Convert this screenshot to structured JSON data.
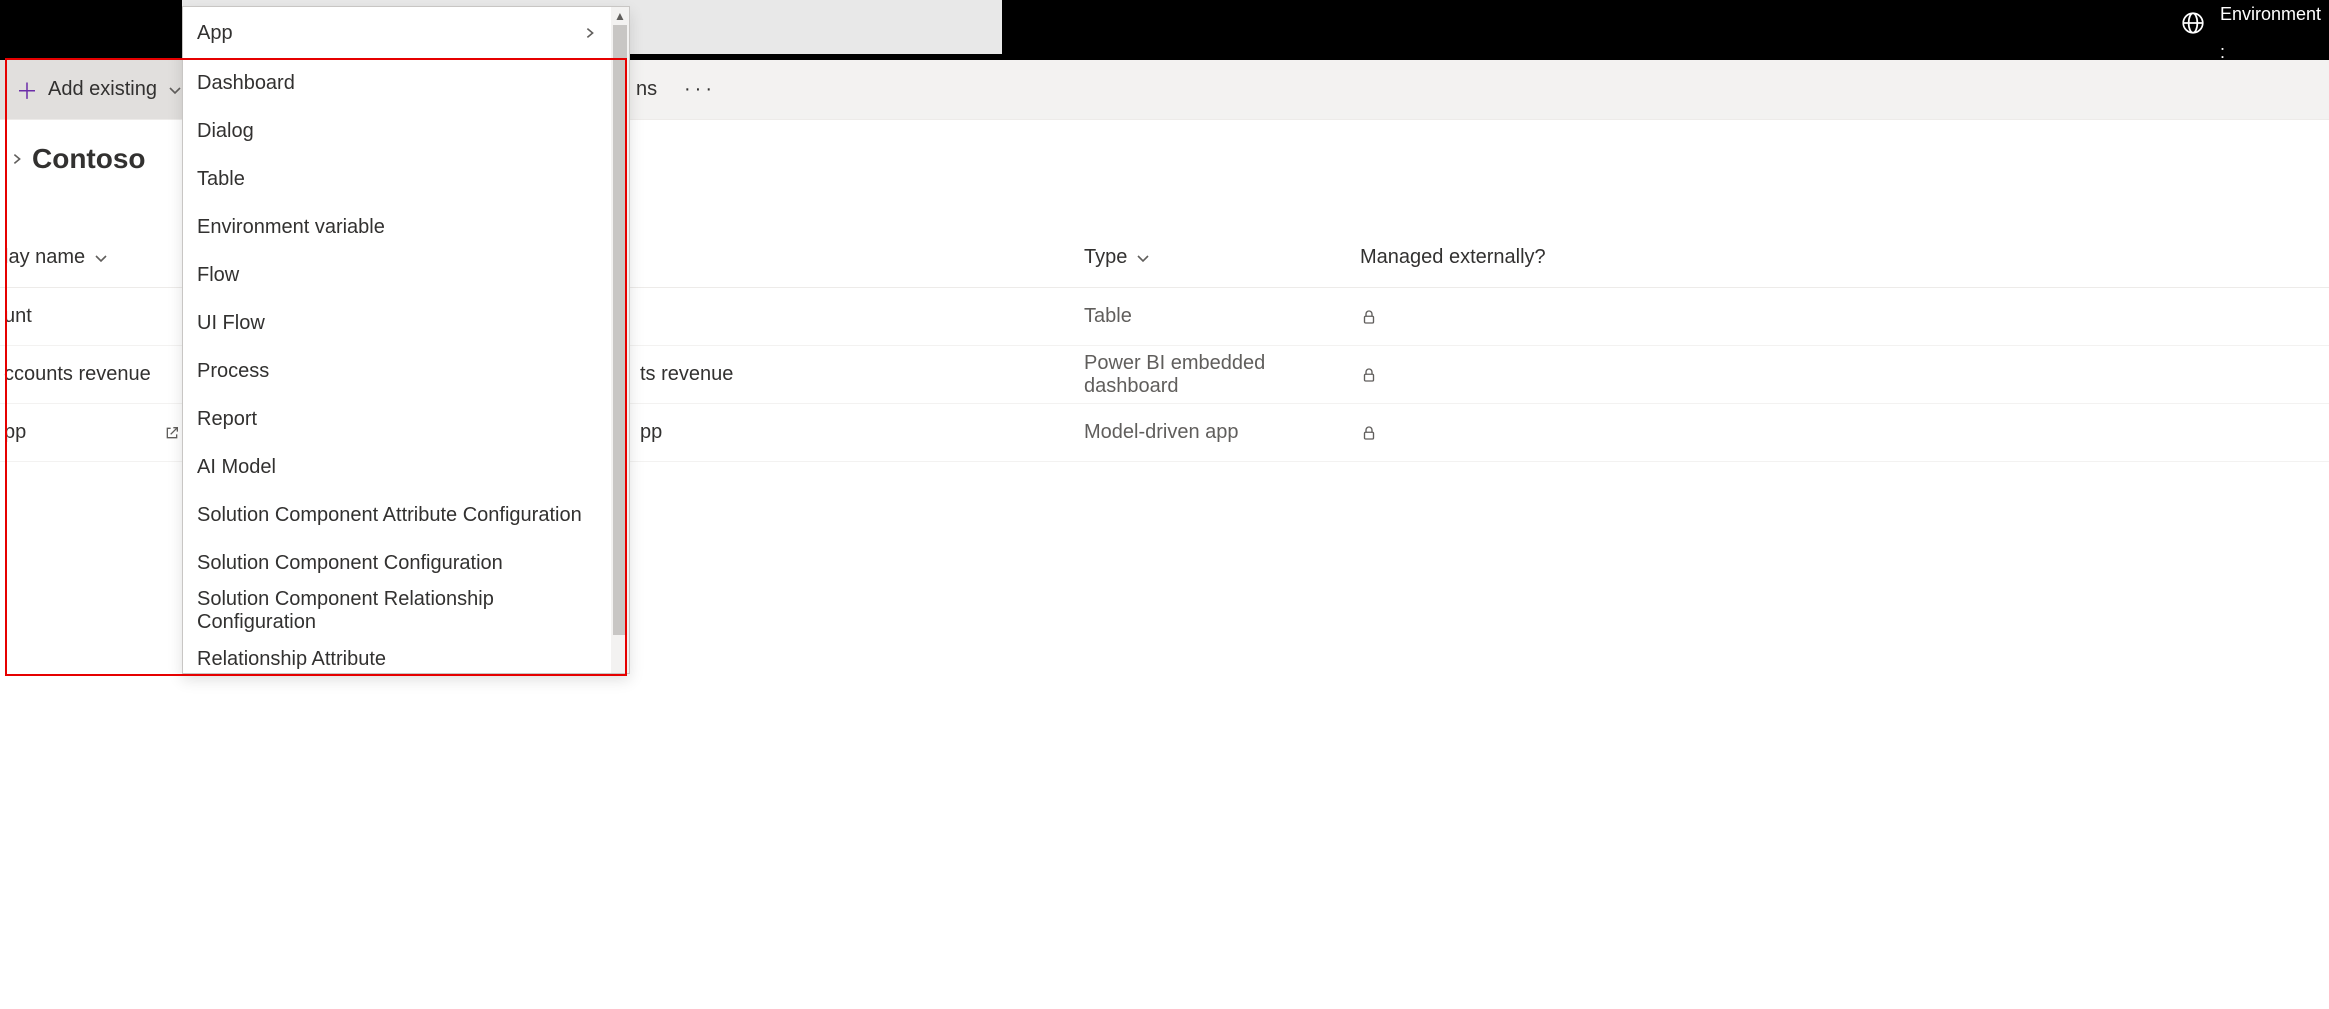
{
  "topbar": {
    "env_label": "Environment",
    "env_colon": ":"
  },
  "commandbar": {
    "add_existing_label": "Add existing",
    "partial_cmd_text": "ns",
    "more": "···"
  },
  "title": {
    "name": "Contoso"
  },
  "menu": {
    "items": [
      {
        "label": "App",
        "has_submenu": true
      },
      {
        "label": "Dashboard"
      },
      {
        "label": "Dialog"
      },
      {
        "label": "Table"
      },
      {
        "label": "Environment variable"
      },
      {
        "label": "Flow"
      },
      {
        "label": "UI Flow"
      },
      {
        "label": "Process"
      },
      {
        "label": "Report"
      },
      {
        "label": "AI Model"
      },
      {
        "label": "Solution Component Attribute Configuration"
      },
      {
        "label": "Solution Component Configuration"
      },
      {
        "label": "Solution Component Relationship Configuration"
      },
      {
        "label": "Relationship Attribute"
      }
    ]
  },
  "table": {
    "columns": {
      "name": "lay name",
      "type": "Type",
      "managed": "Managed externally?"
    },
    "rows": [
      {
        "name": "unt",
        "name_full_partial": "",
        "type": "Table",
        "locked": true,
        "external": false
      },
      {
        "name": "ccounts revenue",
        "name_full_partial": "ts revenue",
        "type": "Power BI embedded dashboard",
        "locked": true,
        "external": false
      },
      {
        "name": "pp",
        "name_full_partial": "pp",
        "type": "Model-driven app",
        "locked": true,
        "external": true
      }
    ]
  }
}
